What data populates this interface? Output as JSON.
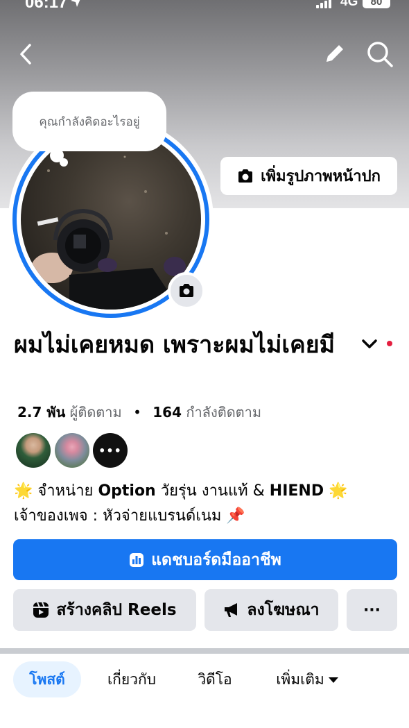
{
  "status_bar": {
    "time": "06:17",
    "network": "4G",
    "battery": "80"
  },
  "cover": {
    "add_cover_label": "เพิ่มรูปภาพหน้าปก"
  },
  "thought_bubble": "คุณกำลังคิดอะไรอยู่",
  "profile": {
    "name": "ผมไม่เคยหมด เพราะผมไม่เคยมี",
    "followers_count": "2.7 พัน",
    "followers_label": "ผู้ติดตาม",
    "separator": "•",
    "following_count": "164",
    "following_label": "กำลังติดตาม",
    "friends_more": "•••"
  },
  "bio": {
    "line1_pre": "จำหน่าย ",
    "line1_bold1": "Option",
    "line1_mid": " วัยรุ่น งานแท้ & ",
    "line1_bold2": "HIEND",
    "line2": "เจ้าของเพจ : หัวจ่ายแบรนด์เนม",
    "emoji_star": "🌟",
    "emoji_pin": "📌"
  },
  "buttons": {
    "dashboard": "แดชบอร์ดมืออาชีพ",
    "create_reels": "สร้างคลิป Reels",
    "advertise": "ลงโฆษณา",
    "more": "···"
  },
  "tabs": [
    {
      "label": "โพสต์",
      "active": true
    },
    {
      "label": "เกี่ยวกับ",
      "active": false
    },
    {
      "label": "วิดีโอ",
      "active": false
    },
    {
      "label": "เพิ่มเติม",
      "active": false
    }
  ],
  "colors": {
    "accent": "#1877f2",
    "secondary_button": "#e4e6eb",
    "notification_dot": "#e41e3f"
  },
  "icons": [
    "back-arrow-icon",
    "pencil-icon",
    "search-icon",
    "camera-icon",
    "chevron-down-icon",
    "dashboard-icon",
    "reels-icon",
    "megaphone-icon",
    "caret-down-icon"
  ]
}
